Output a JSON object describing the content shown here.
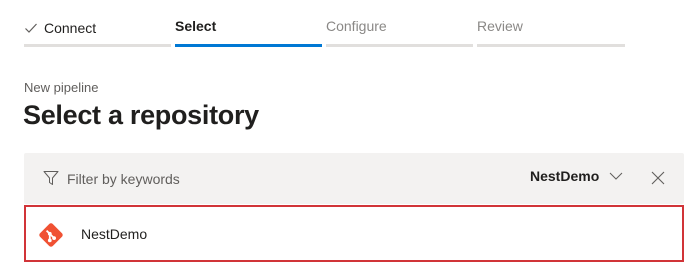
{
  "stepper": {
    "steps": [
      {
        "label": "Connect",
        "state": "done"
      },
      {
        "label": "Select",
        "state": "active"
      },
      {
        "label": "Configure",
        "state": "pending"
      },
      {
        "label": "Review",
        "state": "pending"
      }
    ]
  },
  "header": {
    "subtitle": "New pipeline",
    "title": "Select a repository"
  },
  "filter": {
    "placeholder": "Filter by keywords",
    "value": "",
    "selected_repo": "NestDemo"
  },
  "repositories": [
    {
      "name": "NestDemo",
      "icon": "git-icon",
      "selected": true
    }
  ],
  "colors": {
    "accent": "#0078d4",
    "git": "#f05133",
    "selection_outline": "#d13438"
  }
}
